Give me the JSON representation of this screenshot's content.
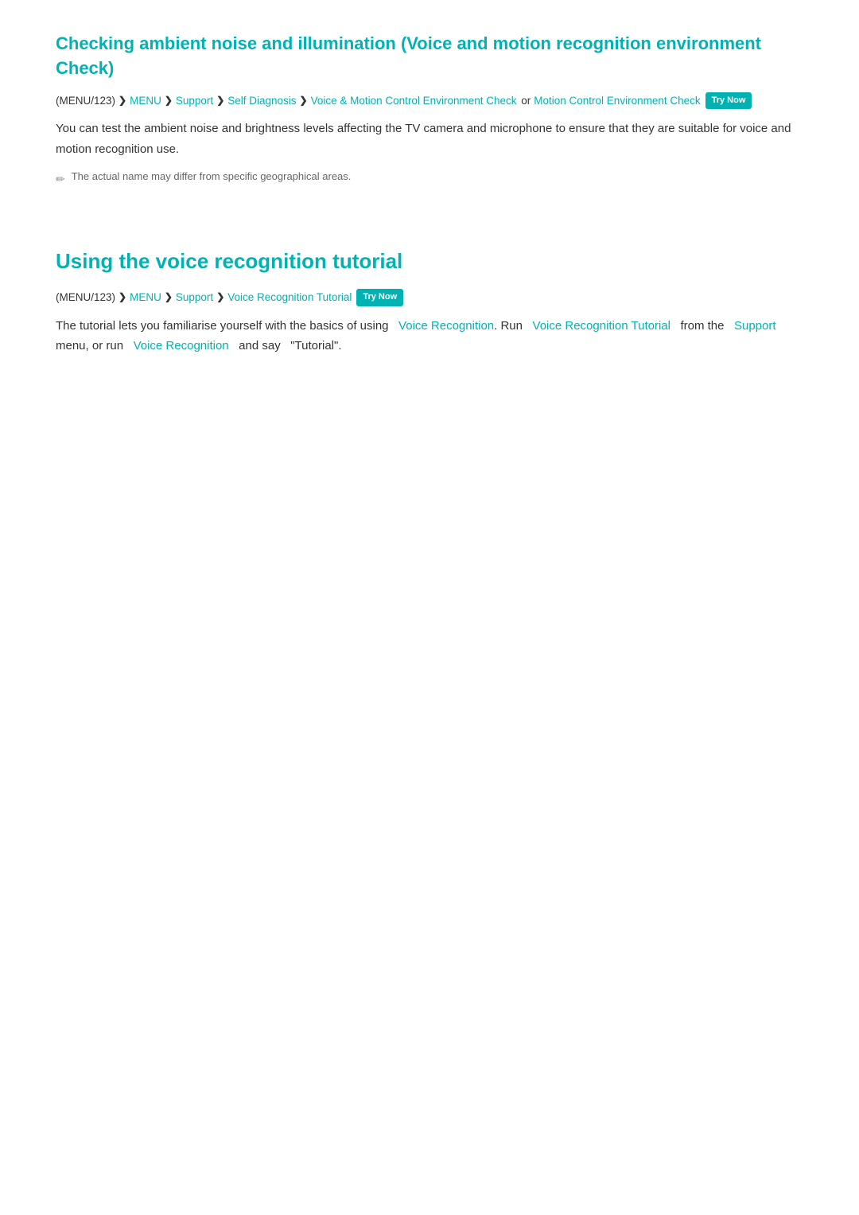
{
  "section1": {
    "title": "Checking ambient noise and illumination (Voice and motion recognition environment Check)",
    "breadcrumb": {
      "menu_code": "(MENU/123)",
      "sep1": "❯",
      "item1": "MENU",
      "sep2": "❯",
      "item2": "Support",
      "sep3": "❯",
      "item3": "Self Diagnosis",
      "sep4": "❯",
      "item4": "Voice & Motion Control Environment Check",
      "connector": "or",
      "item5": "Motion Control Environment Check",
      "try_now": "Try Now"
    },
    "body": "You can test the ambient noise and brightness levels affecting the TV camera and microphone to ensure that they are suitable for voice and motion recognition use.",
    "note": "The actual name may differ from specific geographical areas."
  },
  "section2": {
    "title": "Using the voice recognition tutorial",
    "breadcrumb": {
      "menu_code": "(MENU/123)",
      "sep1": "❯",
      "item1": "MENU",
      "sep2": "❯",
      "item2": "Support",
      "sep3": "❯",
      "item3": "Voice Recognition Tutorial",
      "try_now": "Try Now"
    },
    "body_part1": "The tutorial lets you familiarise yourself with the basics of using",
    "link1": "Voice Recognition",
    "body_part2": ". Run",
    "link2": "Voice Recognition Tutorial",
    "body_part3": "from the",
    "link3": "Support",
    "body_part4": "menu, or run",
    "link4": "Voice Recognition",
    "body_part5": "and say",
    "body_part6": "\"Tutorial\"."
  }
}
